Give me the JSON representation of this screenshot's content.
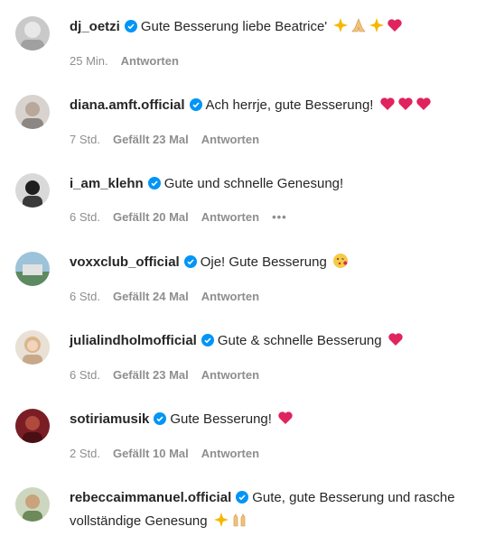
{
  "comments": [
    {
      "username": "dj_oetzi",
      "text": "Gute Besserung liebe Beatrice'",
      "time": "25 Min.",
      "likes": "",
      "reply": "Antworten",
      "more": "",
      "emojis": [
        "sparkles-icon",
        "folded-hands-icon",
        "sparkles-icon",
        "red-heart-icon"
      ]
    },
    {
      "username": "diana.amft.official",
      "text": "Ach herrje, gute Besserung!",
      "time": "7 Std.",
      "likes": "Gefällt 23 Mal",
      "reply": "Antworten",
      "more": "",
      "emojis": [
        "red-heart-icon",
        "red-heart-icon",
        "red-heart-icon"
      ]
    },
    {
      "username": "i_am_klehn",
      "text": "Gute und schnelle Genesung!",
      "time": "6 Std.",
      "likes": "Gefällt 20 Mal",
      "reply": "Antworten",
      "more": "•••",
      "emojis": []
    },
    {
      "username": "voxxclub_official",
      "text": "Oje! Gute Besserung",
      "time": "6 Std.",
      "likes": "Gefällt 24 Mal",
      "reply": "Antworten",
      "more": "",
      "emojis": [
        "kissing-face-icon"
      ]
    },
    {
      "username": "julialindholmofficial",
      "text": "Gute & schnelle Besserung",
      "time": "6 Std.",
      "likes": "Gefällt 23 Mal",
      "reply": "Antworten",
      "more": "",
      "emojis": [
        "red-heart-icon"
      ]
    },
    {
      "username": "sotiriamusik",
      "text": "Gute Besserung!",
      "time": "2 Std.",
      "likes": "Gefällt 10 Mal",
      "reply": "Antworten",
      "more": "",
      "emojis": [
        "red-heart-icon"
      ]
    },
    {
      "username": "rebeccaimmanuel.official",
      "text": "Gute, gute Besserung und rasche vollständige Genesung",
      "time": "",
      "likes": "",
      "reply": "",
      "more": "",
      "emojis": [
        "sparkles-icon",
        "raising-hands-icon"
      ]
    }
  ],
  "colors": {
    "text": "#262626",
    "meta": "#8e8e8e",
    "verified": "#0095f6",
    "heart": "#ed4956"
  }
}
